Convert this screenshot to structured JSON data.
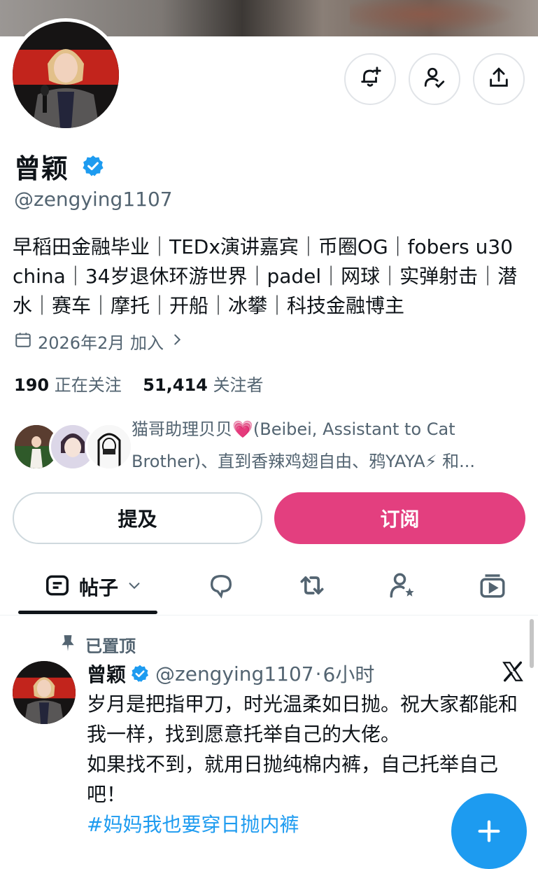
{
  "profile": {
    "name": "曾颖",
    "handle": "@zengying1107",
    "bio": "早稻田金融毕业｜TEDx演讲嘉宾｜币圈OG｜fobers u30 china｜34岁退休环游世界｜padel｜网球｜实弹射击｜潜水｜赛车｜摩托｜开船｜冰攀｜科技金融博主",
    "joined": "2026年2月 加入",
    "following_count": "190",
    "following_label": "正在关注",
    "followers_count": "51,414",
    "followers_label": "关注者"
  },
  "followed_by": {
    "text": "猫哥助理贝贝💗(Beibei, Assistant to Cat Brother)、直到香辣鸡翅自由、鸦YAYA⚡ 和..."
  },
  "actions": {
    "mention_label": "提及",
    "subscribe_label": "订阅"
  },
  "tabs": [
    {
      "label": "帖子",
      "icon": "posts-icon"
    },
    {
      "label": "",
      "icon": "replies-icon"
    },
    {
      "label": "",
      "icon": "reposts-icon"
    },
    {
      "label": "",
      "icon": "highlights-icon"
    },
    {
      "label": "",
      "icon": "media-icon"
    }
  ],
  "pinned_post": {
    "pinned_label": "已置顶",
    "author_name": "曾颖",
    "author_handle": "@zengying1107",
    "time": "6小时",
    "line1": "岁月是把指甲刀，时光温柔如日抛。祝大家都能和我一样，找到愿意托举自己的大佬。",
    "line2": "如果找不到，就用日抛纯棉内裤，自己托举自己吧！",
    "hashtag": "#妈妈我也要穿日抛内裤"
  },
  "colors": {
    "accent": "#1d9bf0",
    "subscribe": "#e33f7f",
    "text": "#0f1419",
    "secondary": "#536471"
  }
}
